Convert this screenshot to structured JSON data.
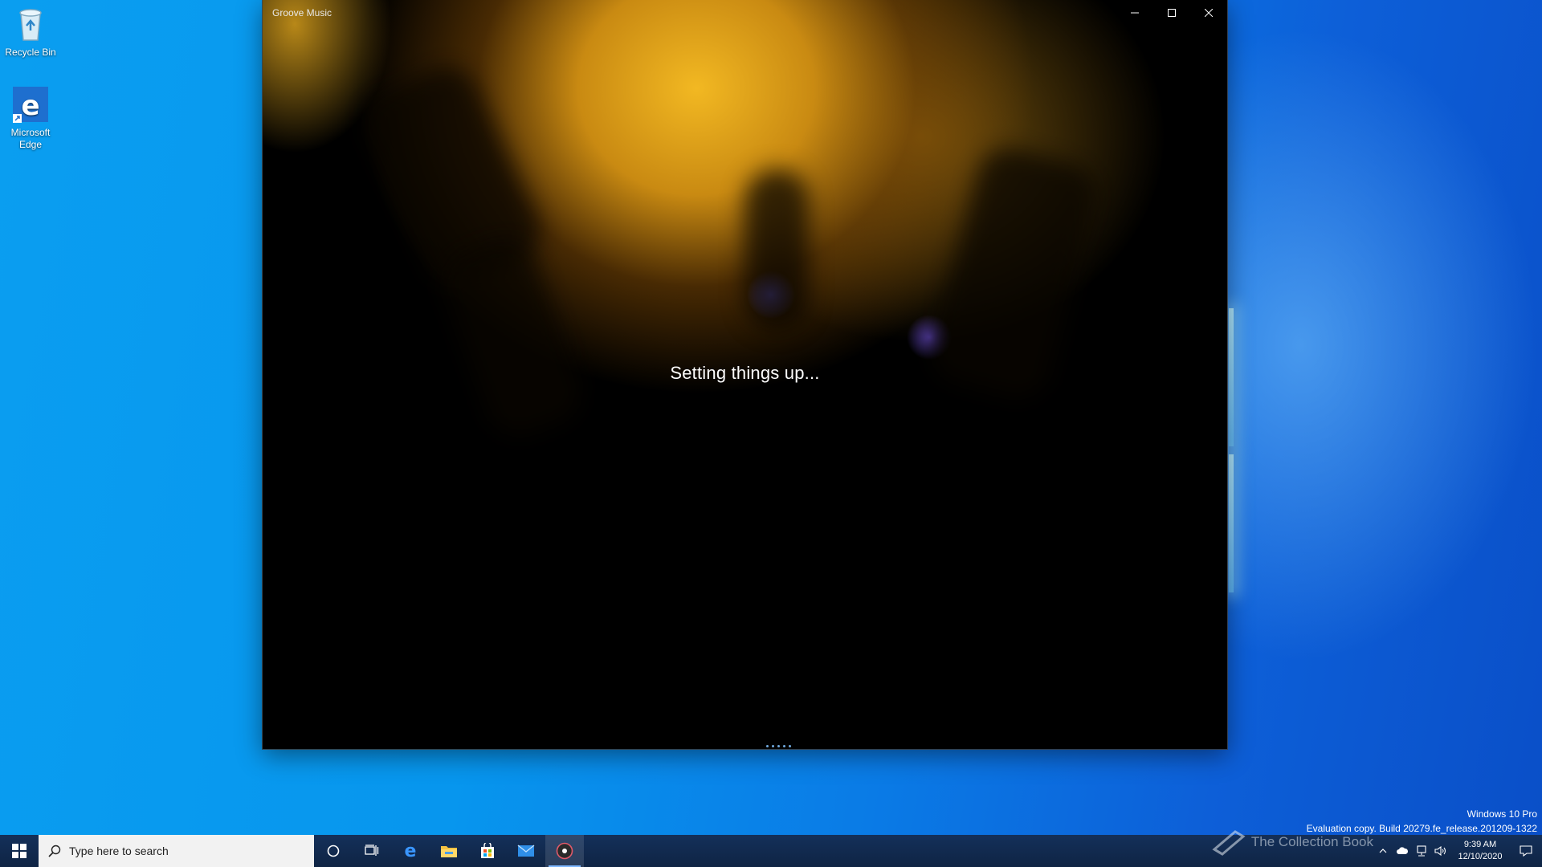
{
  "desktop": {
    "icons": [
      {
        "label": "Recycle Bin",
        "icon": "recycle-bin-icon"
      },
      {
        "label": "Microsoft Edge",
        "icon": "edge-icon"
      }
    ]
  },
  "window": {
    "title": "Groove Music",
    "status_text": "Setting things up...",
    "controls": {
      "minimize": "minimize-icon",
      "maximize": "maximize-icon",
      "close": "close-icon"
    }
  },
  "watermark": {
    "line1": "Windows 10 Pro",
    "line2": "Evaluation copy. Build 20279.fe_release.201209-1322"
  },
  "taskbar": {
    "search_placeholder": "Type here to search",
    "apps": [
      "start-icon",
      "cortana-icon",
      "task-view-icon",
      "edge-icon",
      "file-explorer-icon",
      "store-icon",
      "mail-icon",
      "groove-music-icon"
    ],
    "clock_time": "9:39 AM",
    "clock_date": "12/10/2020",
    "overlay_text": "The Collection Book"
  },
  "colors": {
    "taskbar": "#0f2444",
    "desktop_blue": "#0796ee",
    "window_bg": "#000000",
    "accent": "#7fb8ff"
  }
}
